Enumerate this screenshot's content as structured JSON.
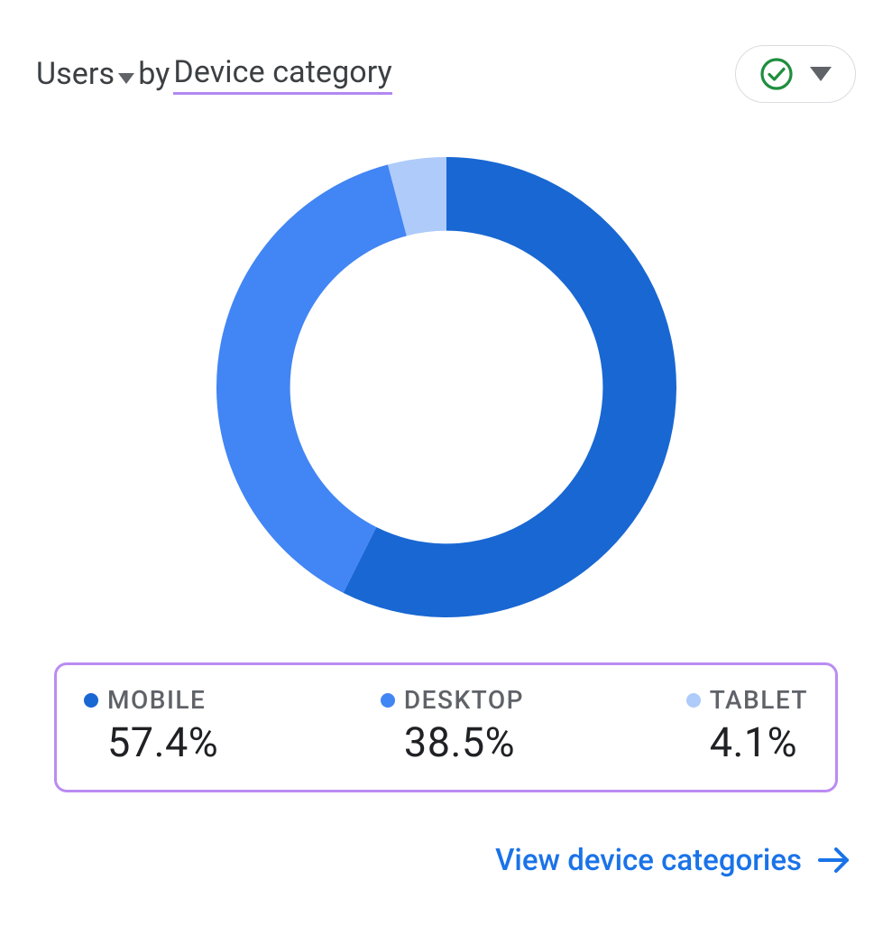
{
  "header": {
    "metric_label": "Users",
    "by_text": "by",
    "dimension_label": "Device category"
  },
  "legend": [
    {
      "label": "MOBILE",
      "value": "57.4%",
      "color": "#1967d2"
    },
    {
      "label": "DESKTOP",
      "value": "38.5%",
      "color": "#4285f4"
    },
    {
      "label": "TABLET",
      "value": "4.1%",
      "color": "#aecbfa"
    }
  ],
  "footer": {
    "link_label": "View device categories"
  },
  "chart_data": {
    "type": "pie",
    "title": "Users by Device category",
    "categories": [
      "MOBILE",
      "DESKTOP",
      "TABLET"
    ],
    "values": [
      57.4,
      38.5,
      4.1
    ],
    "series": [
      {
        "name": "MOBILE",
        "values": [
          57.4
        ],
        "color": "#1967d2"
      },
      {
        "name": "DESKTOP",
        "values": [
          38.5
        ],
        "color": "#4285f4"
      },
      {
        "name": "TABLET",
        "values": [
          4.1
        ],
        "color": "#aecbfa"
      }
    ],
    "donut": true,
    "inner_radius_ratio": 0.68,
    "legend_position": "bottom"
  }
}
